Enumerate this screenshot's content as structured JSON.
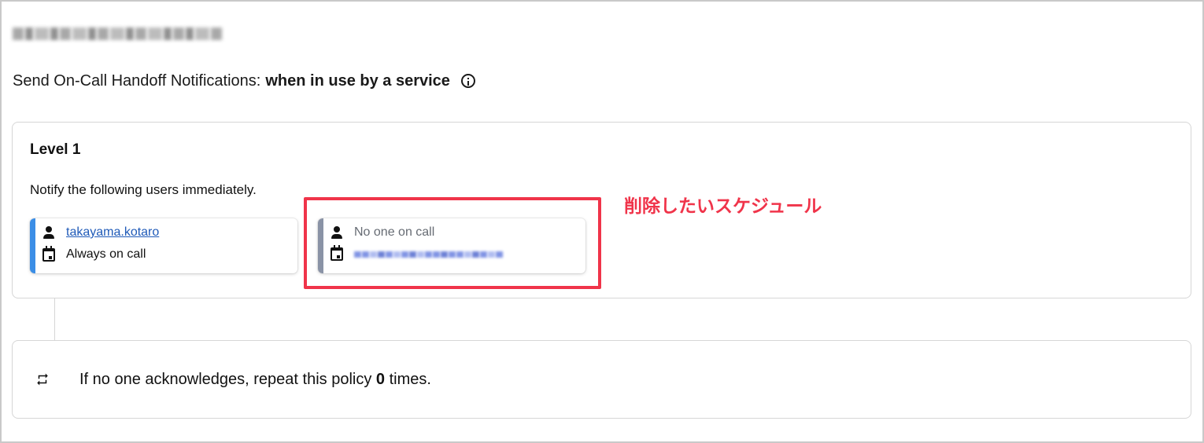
{
  "policy": {
    "title_redacted": "(redacted policy name)"
  },
  "handoff": {
    "label": "Send On-Call Handoff Notifications:",
    "value": "when in use by a service",
    "info_icon": "info-icon"
  },
  "level": {
    "title": "Level 1",
    "description": "Notify the following users immediately.",
    "targets": [
      {
        "person": "takayama.kotaro",
        "schedule": "Always on call",
        "accent_color": "#3b8ee6"
      },
      {
        "person": "No one on call",
        "schedule_redacted": "(redacted schedule link)",
        "accent_color": "#8a93a6"
      }
    ]
  },
  "annotation": {
    "text": "削除したいスケジュール",
    "color": "#f0344a"
  },
  "repeat": {
    "prefix": "If no one acknowledges, repeat this policy",
    "count": "0",
    "suffix": "times."
  }
}
